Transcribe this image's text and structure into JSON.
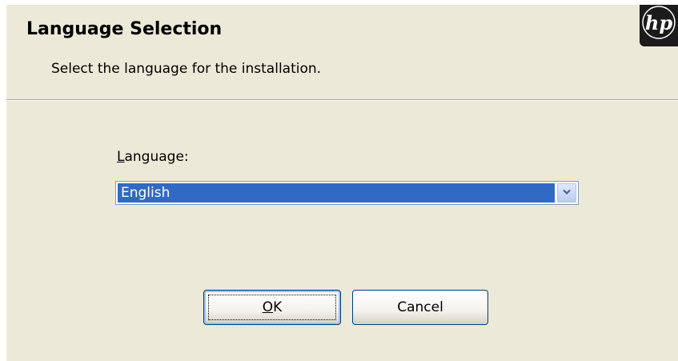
{
  "header": {
    "title": "Language Selection",
    "subtitle": "Select the language for the installation."
  },
  "logo": {
    "text": "hp",
    "brand_color": "#1b1b1b"
  },
  "language": {
    "label_mnemonic": "L",
    "label_rest": "anguage:",
    "selected_value": "English",
    "dropdown_icon": "chevron-down-icon"
  },
  "buttons": {
    "ok_mnemonic": "O",
    "ok_rest": "K",
    "cancel_label": "Cancel"
  },
  "colors": {
    "dialog_background": "#ece9d8",
    "selection_highlight": "#316ac5",
    "button_border": "#003c74"
  }
}
